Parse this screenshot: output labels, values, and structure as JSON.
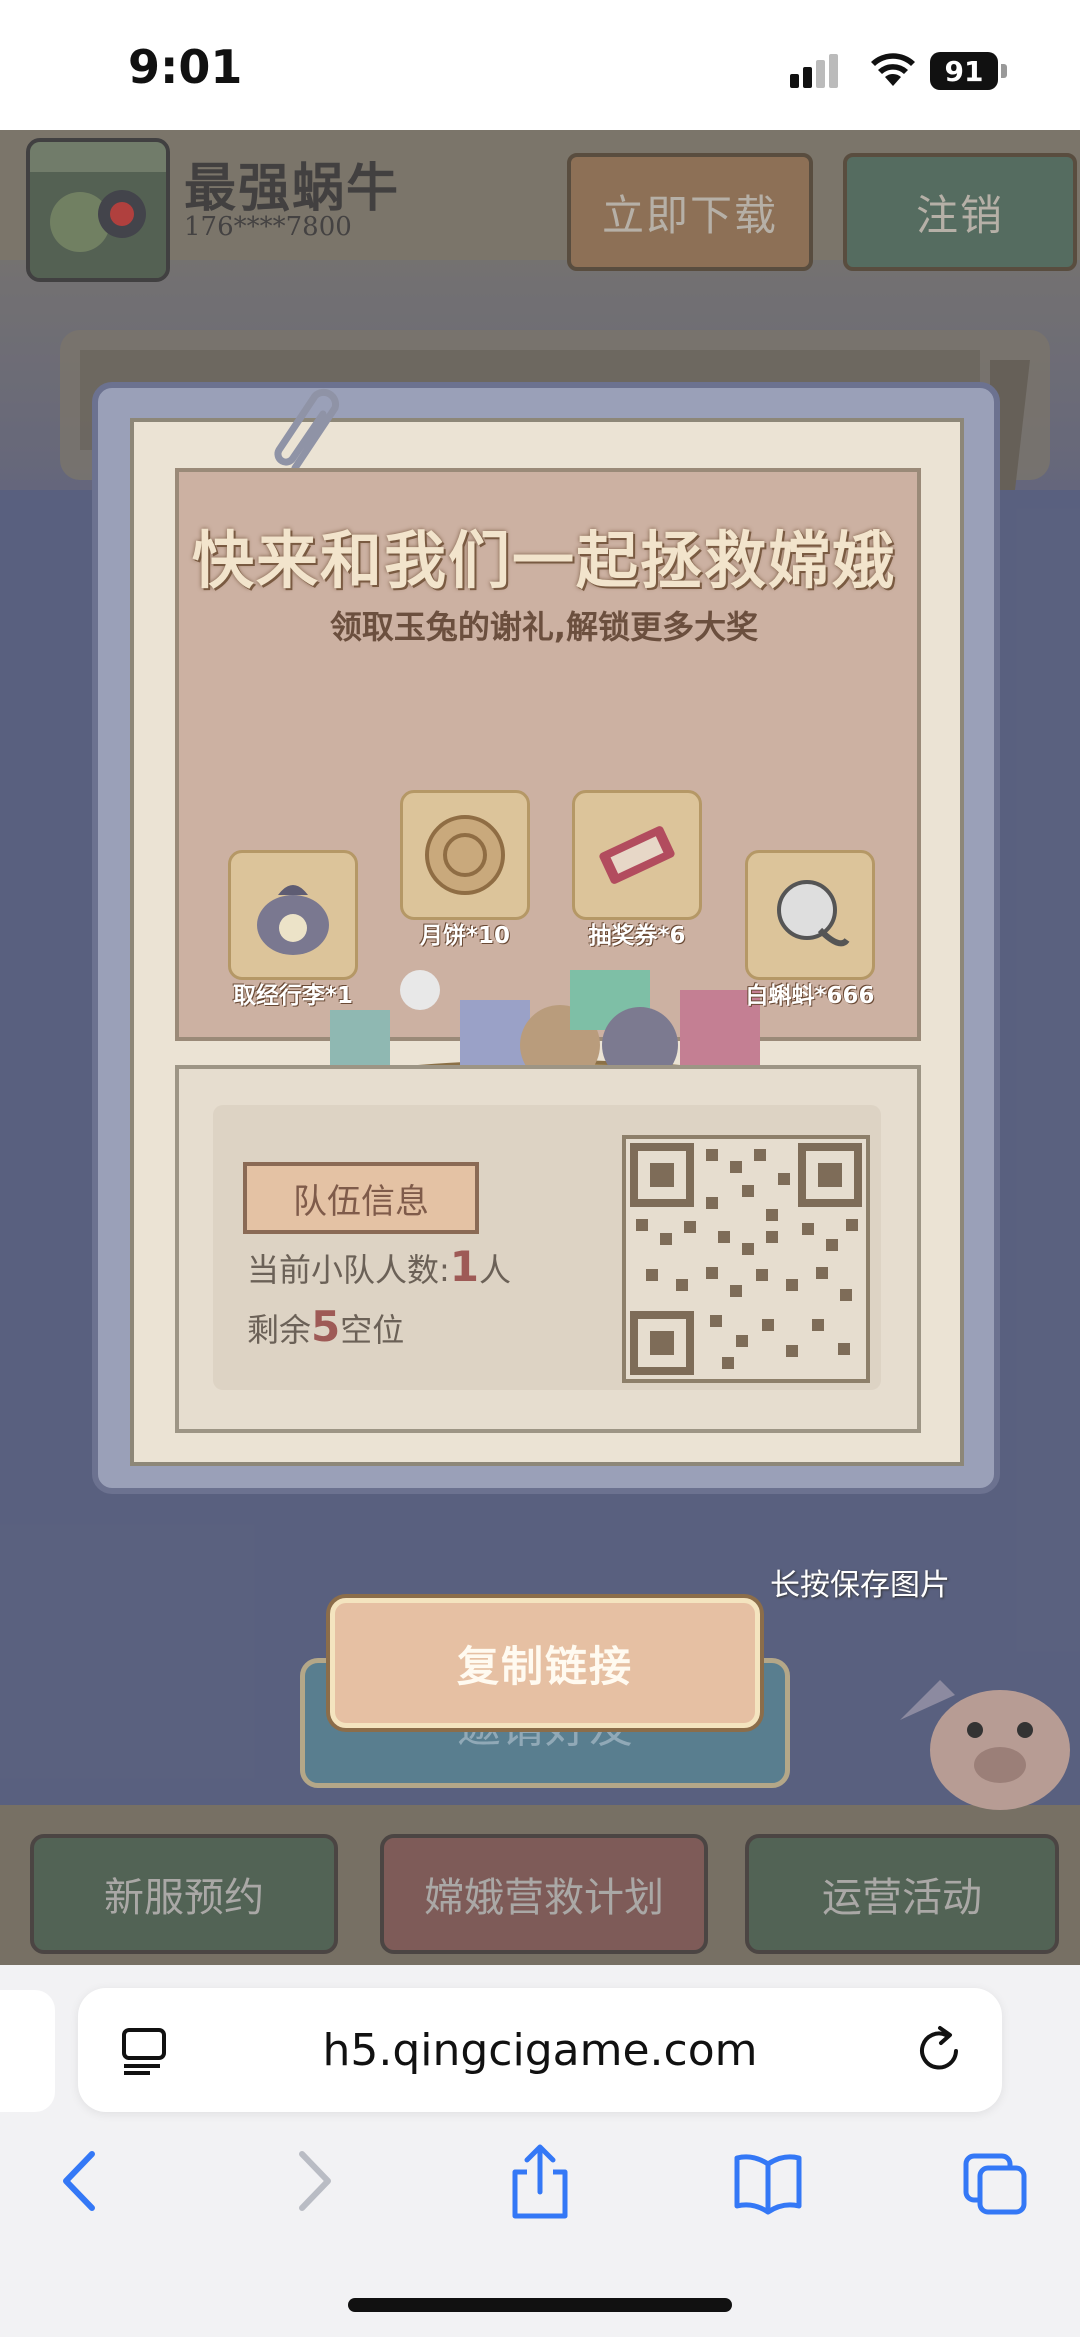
{
  "status_bar": {
    "time": "9:01",
    "battery": "91"
  },
  "game_header": {
    "username": "最强蜗牛",
    "phone": "176****7800",
    "download_label": "立即下载",
    "logout_label": "注销"
  },
  "promo": {
    "title": "快来和我们一起拯救嫦娥",
    "subtitle": "领取玉兔的谢礼,解锁更多大奖",
    "rewards": [
      {
        "label": "取经行李*1",
        "icon": "luggage-bag-icon"
      },
      {
        "label": "月饼*10",
        "icon": "mooncake-icon"
      },
      {
        "label": "抽奖券*6",
        "icon": "lottery-ticket-icon"
      },
      {
        "label": "白蝌蚪*666",
        "icon": "tadpole-icon"
      }
    ]
  },
  "team": {
    "tab_label": "队伍信息",
    "members_prefix": "当前小队人数:",
    "members_count": "1",
    "members_suffix": "人",
    "slots_prefix": "剩余",
    "slots_count": "5",
    "slots_suffix": "空位"
  },
  "actions": {
    "save_hint": "长按保存图片",
    "copy_link_label": "复制链接",
    "invite_label": "邀请好友"
  },
  "bottom_tabs": [
    "新服预约",
    "嫦娥营救计划",
    "运营活动"
  ],
  "browser": {
    "url": "h5.qingcigame.com"
  },
  "colors": {
    "accent": "#3478f6",
    "game_bg": "#5d6585"
  }
}
